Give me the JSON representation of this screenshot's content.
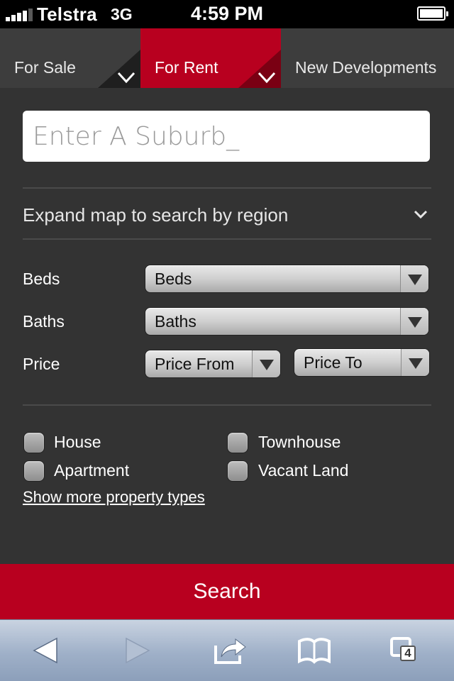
{
  "status_bar": {
    "carrier": "Telstra",
    "network": "3G",
    "time": "4:59 PM"
  },
  "tabs": [
    {
      "label": "For Sale",
      "active": false
    },
    {
      "label": "For Rent",
      "active": true
    },
    {
      "label": "New Developments",
      "active": false
    }
  ],
  "search": {
    "placeholder": "Enter A Suburb_"
  },
  "expand_map": {
    "label": "Expand map to search by region"
  },
  "filters": {
    "beds_label": "Beds",
    "beds_value": "Beds",
    "baths_label": "Baths",
    "baths_value": "Baths",
    "price_label": "Price",
    "price_from_value": "Price From",
    "price_to_value": "Price To"
  },
  "property_types": [
    {
      "label": "House",
      "checked": false
    },
    {
      "label": "Townhouse",
      "checked": false
    },
    {
      "label": "Apartment",
      "checked": false
    },
    {
      "label": "Vacant Land",
      "checked": false
    }
  ],
  "more_types_link": "Show more property types",
  "search_button": "Search",
  "browser_toolbar": {
    "items": [
      "back-icon",
      "forward-icon",
      "share-icon",
      "bookmarks-icon",
      "tabs-icon"
    ],
    "tabs_count": "4"
  },
  "colors": {
    "accent": "#b8001f",
    "background": "#333333",
    "tab_bar": "#3d3d3d"
  }
}
